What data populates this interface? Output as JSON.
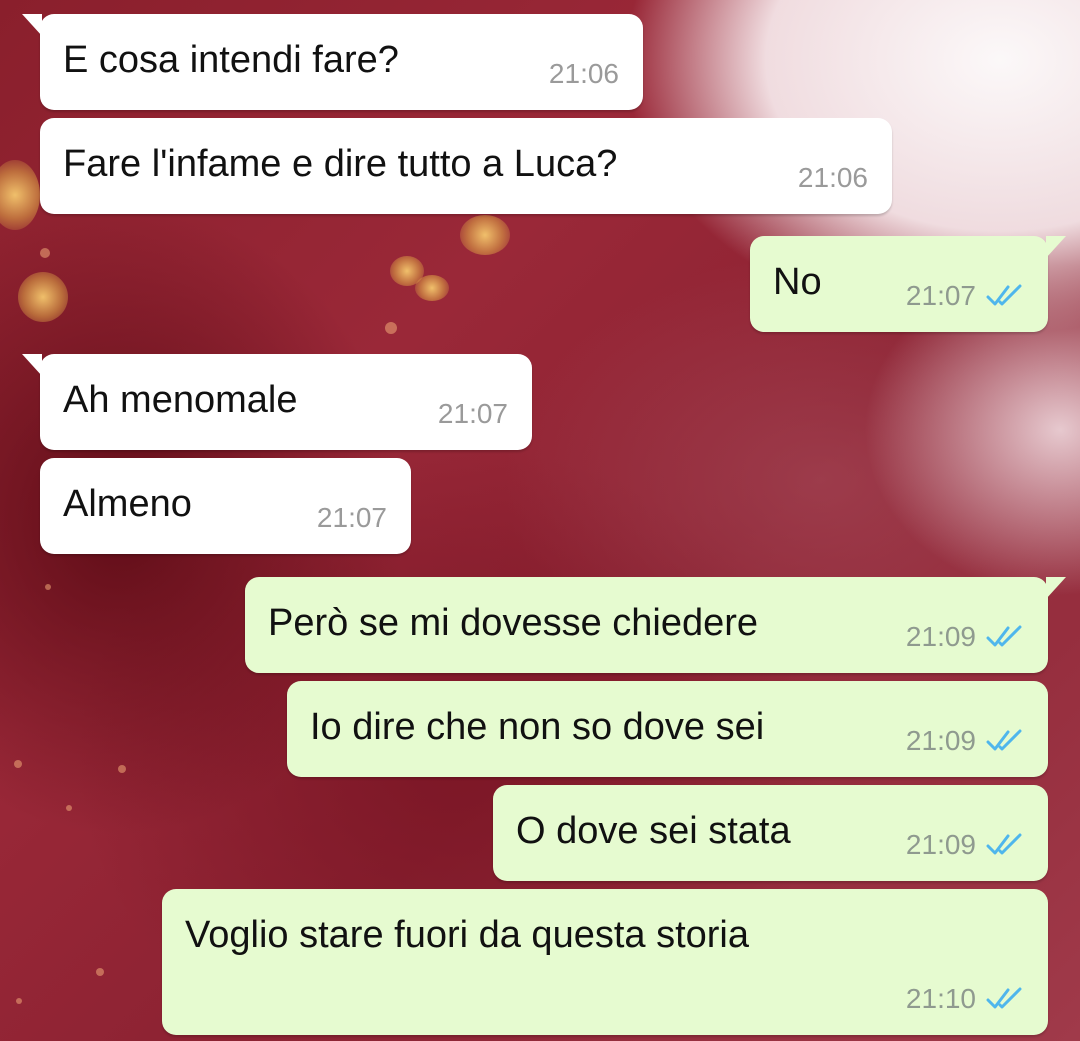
{
  "colors": {
    "incoming_bubble": "#ffffff",
    "outgoing_bubble": "#e6fbd0",
    "read_ticks": "#4fb6ec"
  },
  "messages": [
    {
      "direction": "incoming",
      "text": "E cosa intendi fare?",
      "time": "21:06"
    },
    {
      "direction": "incoming",
      "text": "Fare l'infame e dire tutto a Luca?",
      "time": "21:06"
    },
    {
      "direction": "outgoing",
      "text": "No",
      "time": "21:07",
      "status_icon": "double-check-icon"
    },
    {
      "direction": "incoming",
      "text": "Ah menomale",
      "time": "21:07"
    },
    {
      "direction": "incoming",
      "text": "Almeno",
      "time": "21:07"
    },
    {
      "direction": "outgoing",
      "text": "Però se mi dovesse chiedere",
      "time": "21:09",
      "status_icon": "double-check-icon"
    },
    {
      "direction": "outgoing",
      "text": "Io dire che non so dove sei",
      "time": "21:09",
      "status_icon": "double-check-icon"
    },
    {
      "direction": "outgoing",
      "text": "O dove sei stata",
      "time": "21:09",
      "status_icon": "double-check-icon"
    },
    {
      "direction": "outgoing",
      "text": "Voglio stare fuori da questa storia",
      "time": "21:10",
      "status_icon": "double-check-icon"
    }
  ]
}
